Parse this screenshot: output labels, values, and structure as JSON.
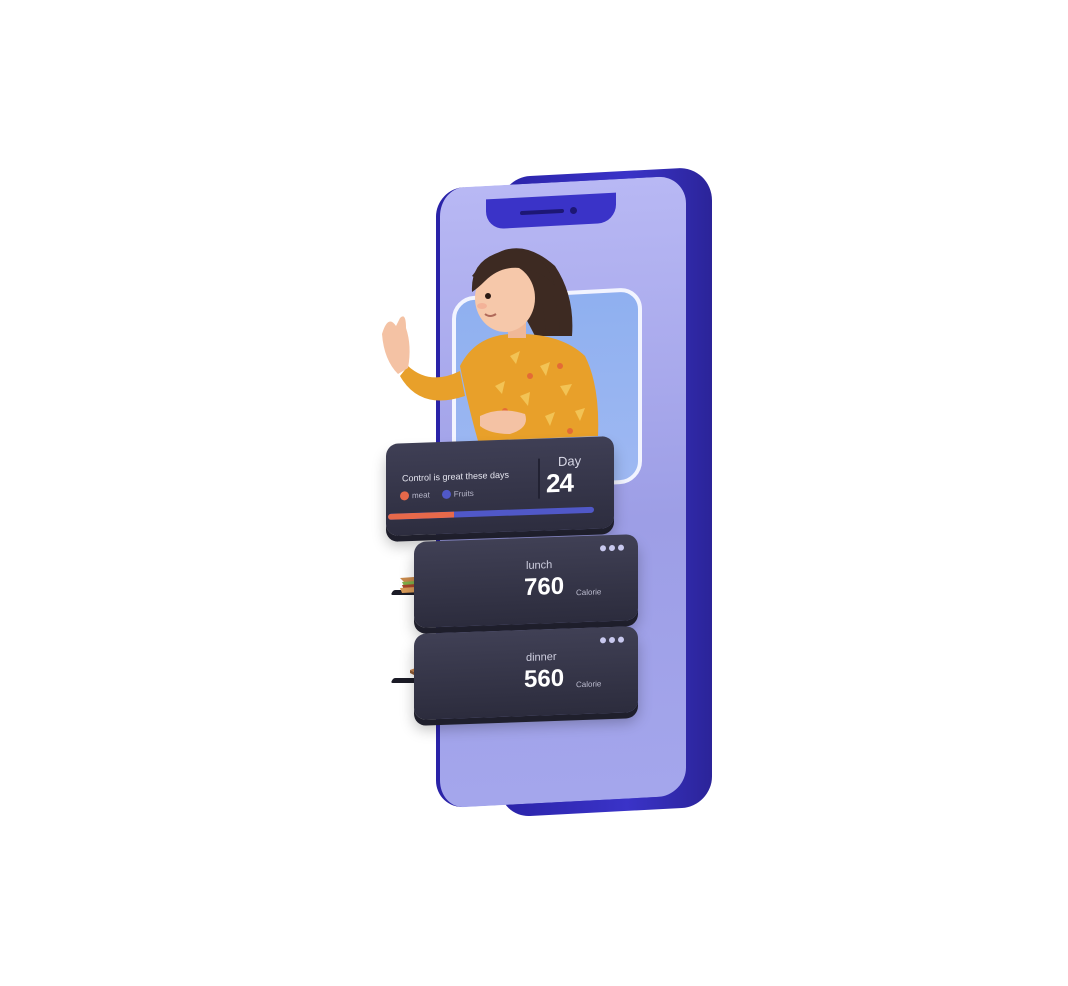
{
  "stats": {
    "message": "Control is great these days",
    "legend": [
      {
        "label": "meat",
        "color": "#e7694a"
      },
      {
        "label": "Fruits",
        "color": "#5058c8"
      }
    ],
    "day_label": "Day",
    "day_number": "24",
    "meat_fraction": 0.32
  },
  "meals": [
    {
      "name": "lunch",
      "calories": "760",
      "unit": "Calorie",
      "icons": [
        "sandwich-icon",
        "cupcake-icon"
      ]
    },
    {
      "name": "dinner",
      "calories": "560",
      "unit": "Calorie",
      "icons": [
        "toast-icon",
        "egg-icon"
      ]
    }
  ],
  "colors": {
    "phone_frame": "#3a33c8",
    "screen": "#b8b8f4",
    "card": "#2d2d3f",
    "accent_meat": "#e7694a",
    "accent_fruits": "#5058c8"
  }
}
